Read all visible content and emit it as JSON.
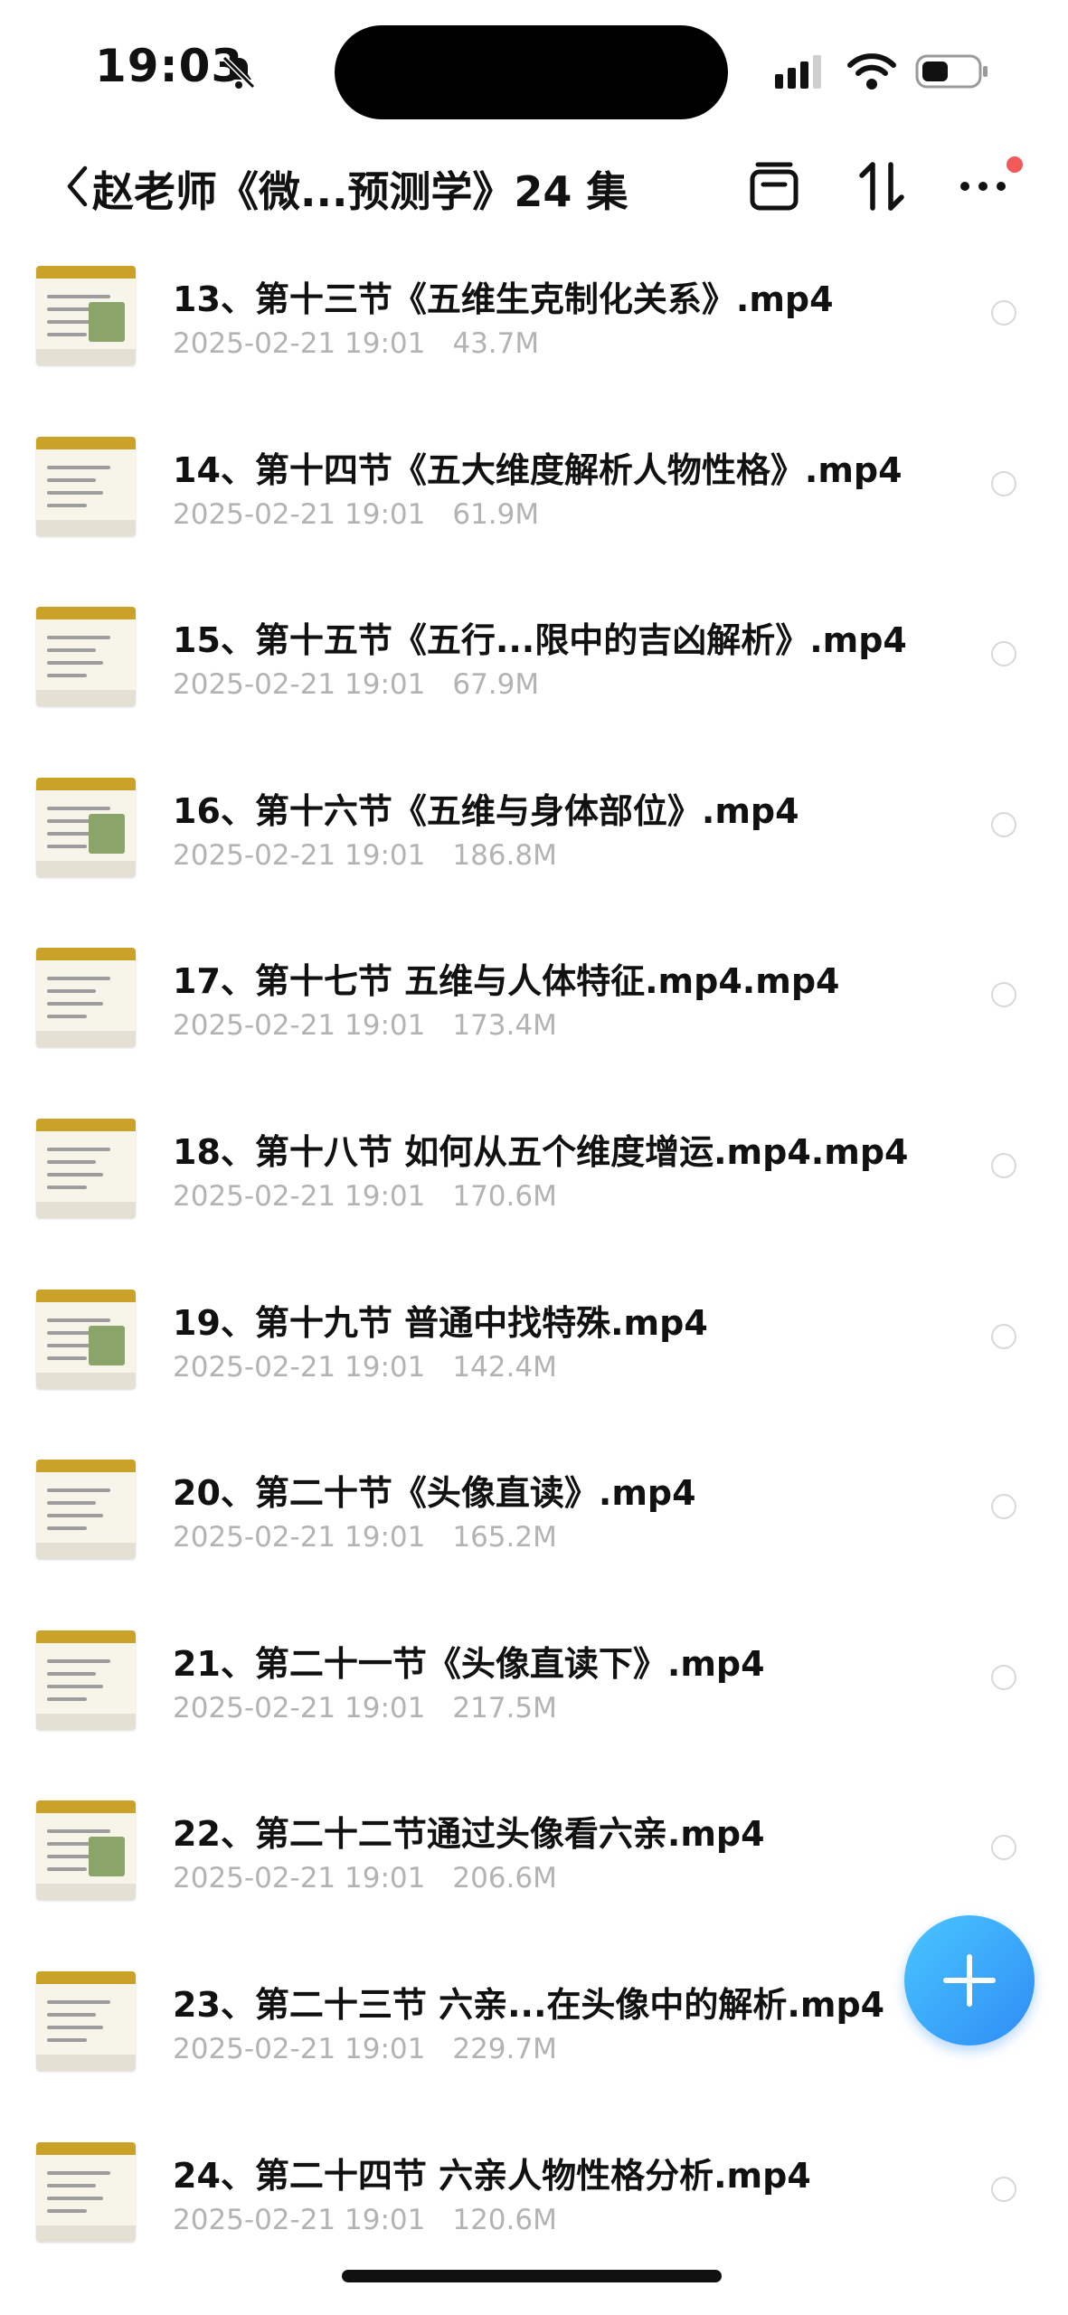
{
  "status_bar": {
    "time": "19:03"
  },
  "nav": {
    "title": "赵老师《微...预测学》24 集"
  },
  "files": [
    {
      "name": "13、第十三节《五维生克制化关系》.mp4",
      "date": "2025-02-21 19:01",
      "size": "43.7M"
    },
    {
      "name": "14、第十四节《五大维度解析人物性格》.mp4",
      "date": "2025-02-21 19:01",
      "size": "61.9M"
    },
    {
      "name": "15、第十五节《五行...限中的吉凶解析》.mp4",
      "date": "2025-02-21 19:01",
      "size": "67.9M"
    },
    {
      "name": "16、第十六节《五维与身体部位》.mp4",
      "date": "2025-02-21 19:01",
      "size": "186.8M"
    },
    {
      "name": "17、第十七节 五维与人体特征.mp4.mp4",
      "date": "2025-02-21 19:01",
      "size": "173.4M"
    },
    {
      "name": "18、第十八节 如何从五个维度增运.mp4.mp4",
      "date": "2025-02-21 19:01",
      "size": "170.6M"
    },
    {
      "name": "19、第十九节 普通中找特殊.mp4",
      "date": "2025-02-21 19:01",
      "size": "142.4M"
    },
    {
      "name": "20、第二十节《头像直读》.mp4",
      "date": "2025-02-21 19:01",
      "size": "165.2M"
    },
    {
      "name": "21、第二十一节《头像直读下》.mp4",
      "date": "2025-02-21 19:01",
      "size": "217.5M"
    },
    {
      "name": "22、第二十二节通过头像看六亲.mp4",
      "date": "2025-02-21 19:01",
      "size": "206.6M"
    },
    {
      "name": "23、第二十三节 六亲...在头像中的解析.mp4",
      "date": "2025-02-21 19:01",
      "size": "229.7M"
    },
    {
      "name": "24、第二十四节 六亲人物性格分析.mp4",
      "date": "2025-02-21 19:01",
      "size": "120.6M"
    }
  ],
  "colors": {
    "accent": "#2f8cf5",
    "notification_dot": "#f25a5a",
    "thumb_header": "#c9a227"
  }
}
